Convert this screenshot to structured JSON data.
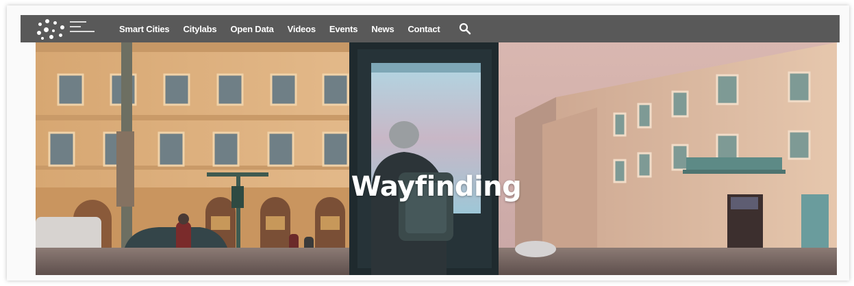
{
  "nav": {
    "items": [
      {
        "label": "Smart Cities"
      },
      {
        "label": "Citylabs"
      },
      {
        "label": "Open Data"
      },
      {
        "label": "Videos"
      },
      {
        "label": "Events"
      },
      {
        "label": "News"
      },
      {
        "label": "Contact"
      }
    ],
    "search_icon": "search-icon"
  },
  "hero": {
    "title": "Wayfinding"
  },
  "colors": {
    "navbar": "#595959",
    "nav_text": "#ffffff"
  }
}
